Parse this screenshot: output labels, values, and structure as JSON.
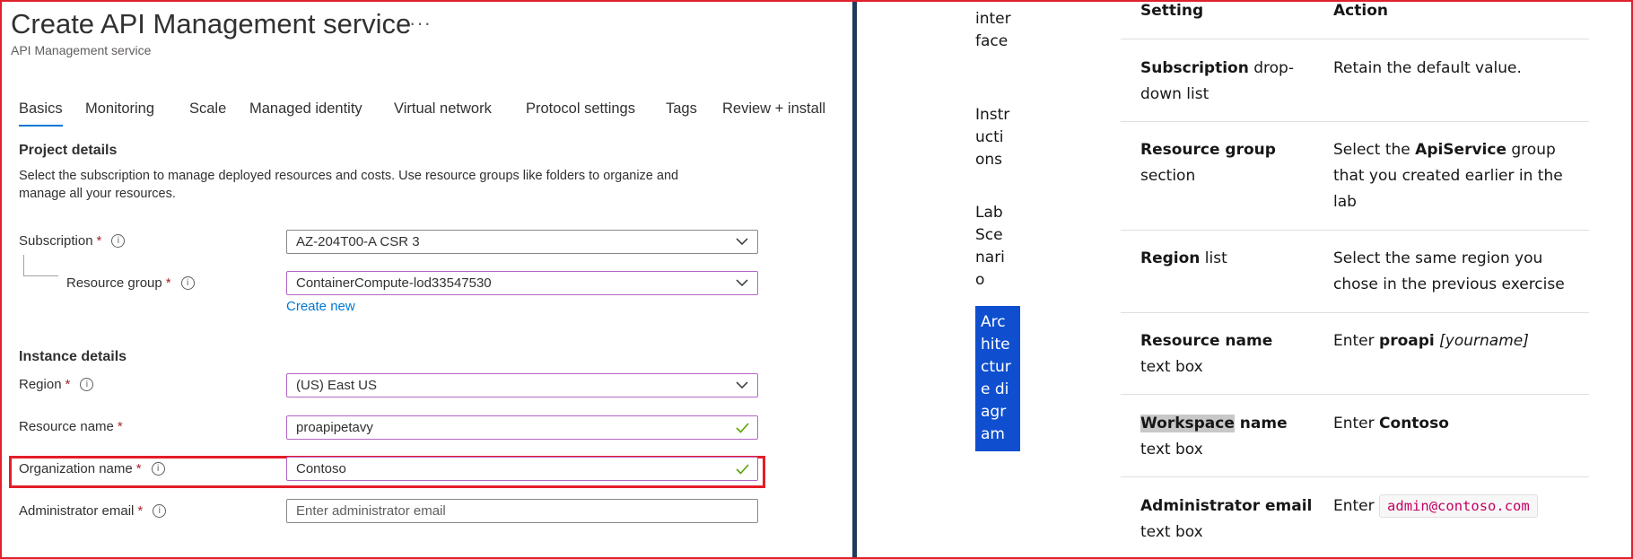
{
  "portal": {
    "title": "Create API Management service",
    "more": "···",
    "subtitle": "API Management service",
    "tabs": [
      "Basics",
      "Monitoring",
      "Scale",
      "Managed identity",
      "Virtual network",
      "Protocol settings",
      "Tags",
      "Review + install"
    ],
    "active_tab": "Basics",
    "project_details": {
      "heading": "Project details",
      "description": "Select the subscription to manage deployed resources and costs. Use resource groups like folders to organize and manage all your resources."
    },
    "subscription": {
      "label": "Subscription",
      "value": "AZ-204T00-A CSR 3"
    },
    "resource_group": {
      "label": "Resource group",
      "value": "ContainerCompute-lod33547530",
      "create_new": "Create new"
    },
    "instance_details": {
      "heading": "Instance details"
    },
    "region": {
      "label": "Region",
      "value": "(US) East US"
    },
    "resource_name": {
      "label": "Resource name",
      "value": "proapipetavy"
    },
    "organization_name": {
      "label": "Organization name",
      "value": "Contoso"
    },
    "admin_email": {
      "label": "Administrator email",
      "placeholder": "Enter administrator email"
    },
    "required_mark": "*",
    "info_glyph": "i",
    "colors": {
      "accent": "#0078d4",
      "highlight_box": "#e31e28",
      "valid_check": "#57a300",
      "focus_border": "#b366c6"
    }
  },
  "docs": {
    "nav": [
      {
        "label": "user interface"
      },
      {
        "label": "Instructions"
      },
      {
        "label": "Lab Scenario"
      },
      {
        "label": "Architecture diagram",
        "active": true
      }
    ],
    "table": {
      "headers": [
        "Setting",
        "Action"
      ],
      "rows": [
        {
          "setting_bold": "Subscription",
          "setting_rest": " drop-down list",
          "action": "Retain the default value."
        },
        {
          "setting_bold": "Resource group",
          "setting_rest": " section",
          "action_pre": "Select the ",
          "action_bold": "ApiService",
          "action_post": " group that you created earlier in the lab"
        },
        {
          "setting_bold": "Region",
          "setting_rest": " list",
          "action": "Select the same region you chose in the previous exercise"
        },
        {
          "setting_bold": "Resource name",
          "setting_rest": " text box",
          "action_pre": "Enter ",
          "action_bold": "proapi",
          "action_italic": " [yourname]"
        },
        {
          "setting_bold_highlight": "Workspace",
          "setting_bold": " name",
          "setting_rest": " text box",
          "action_pre": "Enter ",
          "action_bold": "Contoso"
        },
        {
          "setting_bold": "Administrator email",
          "setting_rest": " text box",
          "action_pre": "Enter ",
          "action_code": "admin@contoso.com"
        }
      ]
    },
    "colors": {
      "nav_active_bg": "#0f4fcf",
      "code_text": "#c40062"
    }
  }
}
